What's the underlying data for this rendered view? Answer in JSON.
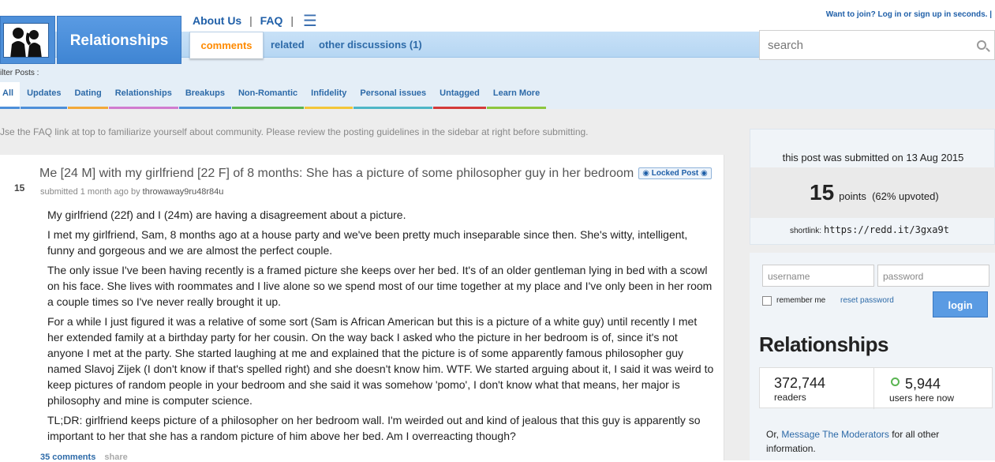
{
  "header": {
    "subreddit_title": "Relationships",
    "about_label": "About Us",
    "faq_label": "FAQ",
    "separator": "|",
    "join_text": "Want to join? Log in or sign up in seconds. |",
    "tabs": {
      "comments": "comments",
      "related": "related",
      "other": "other discussions (1)"
    },
    "search_placeholder": "search"
  },
  "filters": {
    "label": "ilter Posts :",
    "items": [
      {
        "label": "All",
        "color": "#4d8fd9"
      },
      {
        "label": "Updates",
        "color": "#4d8fd9"
      },
      {
        "label": "Dating",
        "color": "#f2a93b"
      },
      {
        "label": "Relationships",
        "color": "#d07cd0"
      },
      {
        "label": "Breakups",
        "color": "#4d8fd9"
      },
      {
        "label": "Non-Romantic",
        "color": "#5ab552"
      },
      {
        "label": "Infidelity",
        "color": "#f2c63b"
      },
      {
        "label": "Personal issues",
        "color": "#4db6c7"
      },
      {
        "label": "Untagged",
        "color": "#d33b3b"
      },
      {
        "label": "Learn More",
        "color": "#8cc63f"
      }
    ]
  },
  "notice": "Jse the FAQ link at top to familiarize yourself about community. Please review the posting guidelines in the sidebar at right before submitting.",
  "post": {
    "score": "15",
    "title": "Me [24 M] with my girlfriend [22 F] of 8 months: She has a picture of some philosopher guy in her bedroom",
    "flair": "Locked Post",
    "submitted": "submitted 1 month ago by",
    "author": "throwaway9ru48r84u",
    "paragraphs": [
      "My girlfriend (22f) and I (24m) are having a disagreement about a picture.",
      "I met my girlfriend, Sam, 8 months ago at a house party and we've been pretty much inseparable since then. She's witty, intelligent, funny and gorgeous and we are almost the perfect couple.",
      "The only issue I've been having recently is a framed picture she keeps over her bed. It's of an older gentleman lying in bed with a scowl on his face. She lives with roommates and I live alone so we spend most of our time together at my place and I've only been in her room a couple times so I've never really brought it up.",
      "For a while I just figured it was a relative of some sort (Sam is African American but this is a picture of a white guy) until recently I met her extended family at a birthday party for her cousin. On the way back I asked who the picture in her bedroom is of, since it's not anyone I met at the party. She started laughing at me and explained that the picture is of some apparently famous philosopher guy named Slavoj Zijek (I don't know if that's spelled right) and she doesn't know him. WTF. We started arguing about it, I said it was weird to keep pictures of random people in your bedroom and she said it was somehow 'pomo', I don't know what that means, her major is philosophy and mine is computer science.",
      "TL;DR: girlfriend keeps picture of a philosopher on her bedroom wall. I'm weirded out and kind of jealous that this guy is apparently so important to her that she has a random picture of him above her bed. Am I overreacting though?"
    ],
    "comments": "35 comments",
    "share": "share"
  },
  "sidebar": {
    "submitted_on": "this post was submitted on 13 Aug 2015",
    "points": "15",
    "points_label": "points",
    "upvoted": "(62% upvoted)",
    "shortlink_label": "shortlink:",
    "shortlink": "https://redd.it/3gxa9t",
    "username_placeholder": "username",
    "password_placeholder": "password",
    "remember": "remember me",
    "reset": "reset password",
    "login": "login",
    "sub_name": "Relationships",
    "readers": "372,744",
    "readers_label": "readers",
    "online": "5,944",
    "online_label": "users here now",
    "mods_prefix": "Or,",
    "mods_link": "Message The Moderators",
    "mods_suffix": "for all other information."
  }
}
